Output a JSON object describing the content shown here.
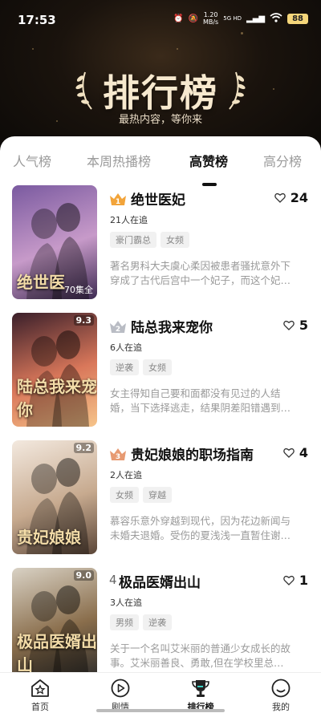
{
  "status_bar": {
    "time": "17:53",
    "net_speed": "1.20",
    "net_unit": "MB/s",
    "net_type": "5G HD",
    "battery": "88"
  },
  "header": {
    "title": "排行榜",
    "subtitle": "最热内容，等你来"
  },
  "tabs": [
    {
      "label": "人气榜",
      "active": false
    },
    {
      "label": "本周热播榜",
      "active": false
    },
    {
      "label": "高赞榜",
      "active": true
    },
    {
      "label": "高分榜",
      "active": false
    }
  ],
  "items": [
    {
      "rank": "1",
      "title": "绝世医妃",
      "likes": "24",
      "followers": "21人在追",
      "tags": [
        "豪门霸总",
        "女频"
      ],
      "description": "著名男科大夫虞心柔因被患者骚扰意外下穿成了古代后宫中一个妃子，而这个妃…",
      "cover_text": "绝世医",
      "cover_score": "",
      "episodes": "70集全",
      "cover_colors": [
        "#7a5aa0",
        "#c79ac9",
        "#3e2b52"
      ],
      "badge_color": "#f2a43a"
    },
    {
      "rank": "2",
      "title": "陆总我来宠你",
      "likes": "5",
      "followers": "6人在追",
      "tags": [
        "逆袭",
        "女频"
      ],
      "description": "女主得知自己要和面都没有见过的人结婚，当下选择逃走，结果阴差阳错遇到…",
      "cover_text": "陆总我来宠你",
      "cover_score": "9.3",
      "episodes": "",
      "cover_colors": [
        "#3a1f2a",
        "#d9775a",
        "#f6c48a"
      ],
      "badge_color": "#b9bcc4"
    },
    {
      "rank": "3",
      "title": "贵妃娘娘的职场指南",
      "likes": "4",
      "followers": "2人在追",
      "tags": [
        "女频",
        "穿越"
      ],
      "description": "慕容乐意外穿越到现代，因为花边新闻与未婚夫退婚。受伤的夏浅浅一直暂住谢…",
      "cover_text": "贵妃娘娘",
      "cover_score": "9.2",
      "episodes": "",
      "cover_colors": [
        "#f3e9df",
        "#c7aa8f",
        "#5b4638"
      ],
      "badge_color": "#e79a72"
    },
    {
      "rank": "4",
      "title": "极品医婿出山",
      "likes": "1",
      "followers": "3人在追",
      "tags": [
        "男频",
        "逆袭"
      ],
      "description": "关于一个名叫艾米丽的普通少女成长的故事。艾米丽善良、勇敢,但在学校里总…",
      "cover_text": "极品医婿出山",
      "cover_score": "9.0",
      "episodes": "",
      "cover_colors": [
        "#d9d2c5",
        "#8a6e4c",
        "#2a2a2a"
      ],
      "badge_color": ""
    }
  ],
  "bottom_nav": [
    {
      "label": "首页",
      "icon": "home-star-icon",
      "active": false
    },
    {
      "label": "剧情",
      "icon": "play-circle-icon",
      "active": false
    },
    {
      "label": "排行榜",
      "icon": "trophy-icon",
      "active": true
    },
    {
      "label": "我的",
      "icon": "profile-icon",
      "active": false
    }
  ]
}
